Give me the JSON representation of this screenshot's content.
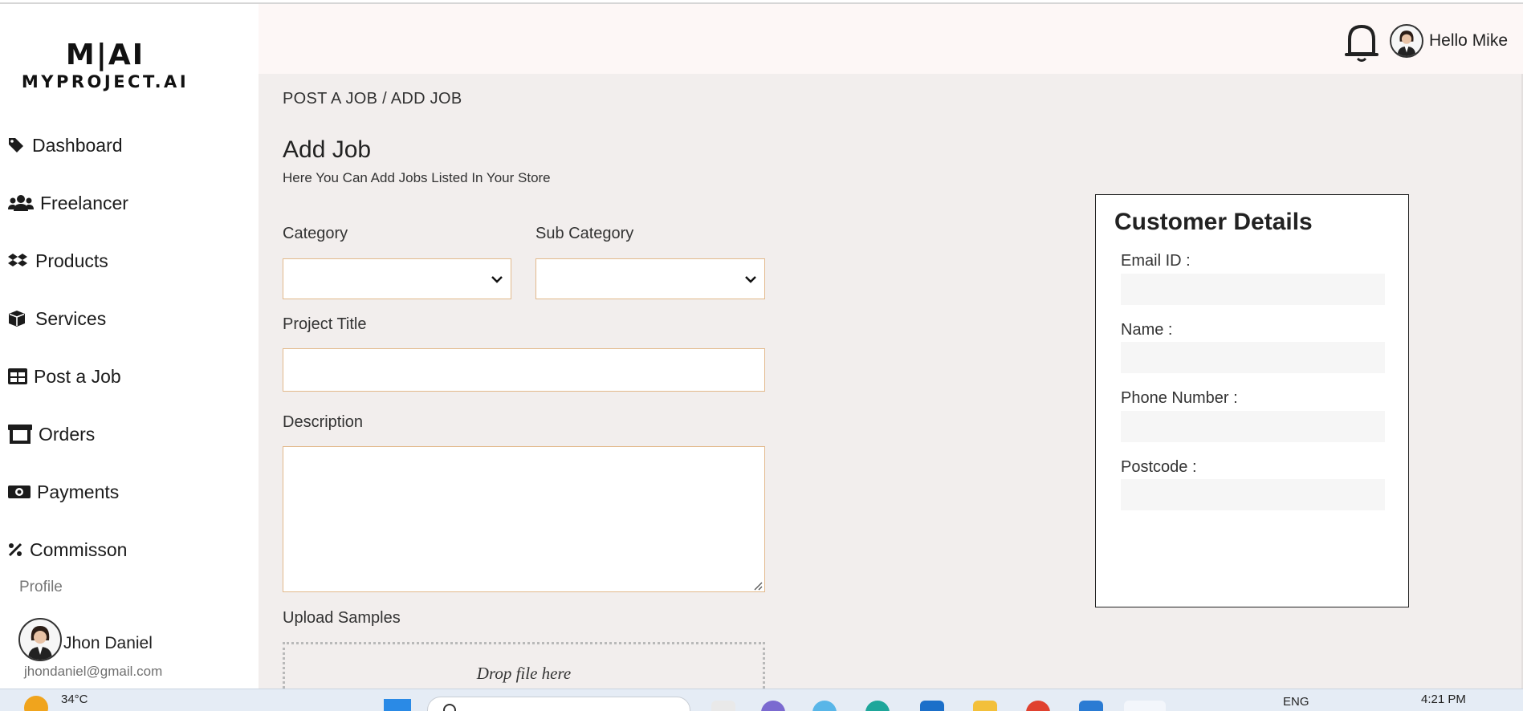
{
  "brand": {
    "mark": "M|AI",
    "name": "MYPROJECT.AI"
  },
  "sidebar": {
    "items": [
      {
        "label": "Dashboard",
        "icon": "tag-icon"
      },
      {
        "label": "Freelancer",
        "icon": "users-icon"
      },
      {
        "label": "Products",
        "icon": "dropbox-icon"
      },
      {
        "label": "Services",
        "icon": "cube-icon"
      },
      {
        "label": "Post a Job",
        "icon": "table-icon"
      },
      {
        "label": "Orders",
        "icon": "store-icon"
      },
      {
        "label": "Payments",
        "icon": "money-bill-icon"
      },
      {
        "label": "Commisson",
        "icon": "percent-icon"
      }
    ],
    "profile_label": "Profile",
    "profile_name": "Jhon Daniel",
    "profile_email": "jhondaniel@gmail.com"
  },
  "header": {
    "greeting": "Hello Mike"
  },
  "main": {
    "breadcrumb": "POST A JOB / ADD JOB",
    "title": "Add Job",
    "subtitle": "Here You Can Add Jobs Listed In Your Store",
    "form": {
      "category_label": "Category",
      "category_value": "",
      "subcategory_label": "Sub Category",
      "subcategory_value": "",
      "project_title_label": "Project Title",
      "project_title_value": "",
      "description_label": "Description",
      "description_value": "",
      "upload_label": "Upload Samples",
      "dropzone_text": "Drop file here"
    },
    "customer": {
      "title": "Customer Details",
      "email_label": "Email ID :",
      "name_label": "Name :",
      "phone_label": "Phone Number :",
      "postcode_label": "Postcode :"
    }
  },
  "taskbar": {
    "temperature": "34°C",
    "language": "ENG",
    "time": "4:21 PM"
  },
  "colors": {
    "field_border": "#e2b98b",
    "main_bg": "#f2eeed",
    "header_bg": "#fdf7f6"
  }
}
